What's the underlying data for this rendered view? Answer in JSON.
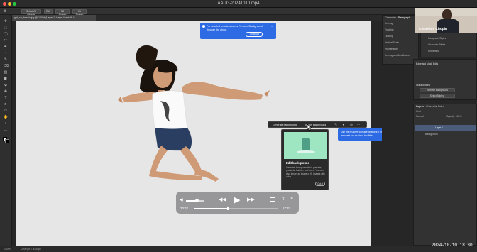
{
  "window": {
    "title": "AAUG-20241010.mp4"
  },
  "options_bar": {
    "buttons": [
      "Select All Objects",
      "Edit",
      "Fill Screen",
      "Fit Screen"
    ]
  },
  "document": {
    "tab_label": "girl_on_bench.jpg @ 100% (Layer 1, Layer Mask/8) *"
  },
  "notice": {
    "text": "For detailed results process Remove Background through the cloud.",
    "button": "Try cloud",
    "close": "×"
  },
  "context_bar": {
    "generate_label": "Generate background",
    "import_label": "Import background",
    "more": "···"
  },
  "tooltip": {
    "text": "Use the brushes to make changes if you've removed too much or too little."
  },
  "gen_card": {
    "title": "Edit background",
    "description": "Generate backgrounds for portraits, products, fashion, and more. You can also import an image or fill images with color.",
    "next_label": "Got it"
  },
  "player": {
    "elapsed": "20:32",
    "remaining": "57:32",
    "progress": 0.4,
    "volume": 0.6
  },
  "status": {
    "zoom": "100%",
    "size": "2000 px x 3000 px"
  },
  "right_panel": {
    "char_tabs": [
      "Character",
      "Paragraph"
    ],
    "char_rows": [
      "Kerning",
      "Tracking",
      "Leading",
      "Vertical Scale",
      "Hyphenation",
      "Kerning and Justification"
    ],
    "mini_items": [
      "Plugins",
      "Channels",
      "Paragraph",
      "Paragraph Styles",
      "Character Styles",
      "Properties"
    ],
    "edge_title": "Edge and Mask Edits",
    "actions_title": "Quick Actions",
    "action_buttons": [
      "Remove Background",
      "Select Subject"
    ],
    "layers_tabs": [
      "Layers",
      "Channels",
      "Paths"
    ],
    "layers_search": "Kind",
    "layers_blend": "Normal",
    "layers_opacity": "Opacity: 100%",
    "layers": [
      {
        "name": "Layer 1"
      },
      {
        "name": "Background"
      }
    ]
  },
  "webcam": {
    "name": "Cornelius Chopin"
  },
  "timestamp": "2024-10-10  18:30"
}
